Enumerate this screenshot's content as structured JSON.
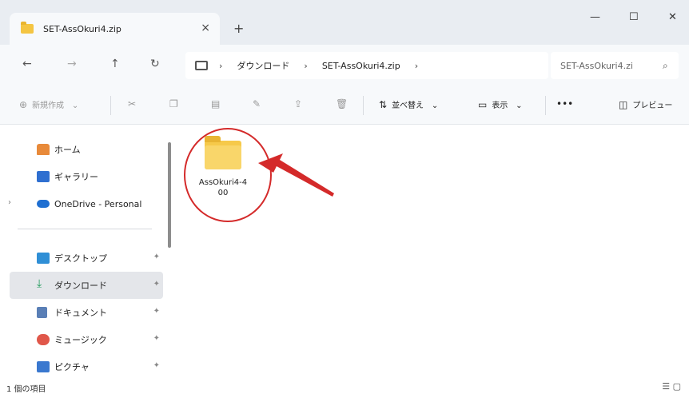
{
  "window": {
    "tab_title": "SET-AssOkuri4.zip",
    "tab_close": "×",
    "new_tab": "+",
    "minimize": "—",
    "maximize": "☐",
    "close": "✕"
  },
  "address": {
    "back": "←",
    "forward": "→",
    "up": "↑",
    "refresh": "↻",
    "breadcrumbs": [
      "ダウンロード",
      "SET-AssOkuri4.zip"
    ],
    "separator": "›",
    "search_placeholder": "SET-AssOkuri4.zi",
    "search_icon": "⌕"
  },
  "toolbar": {
    "new_label": "新規作成",
    "sort_label": "並べ替え",
    "view_label": "表示",
    "more_label": "•••",
    "preview_label": "プレビュー",
    "dropdown_arrow": "⌄"
  },
  "sidebar": {
    "items": [
      {
        "label": "ホーム",
        "icon": "home-icon",
        "pinned": false
      },
      {
        "label": "ギャラリー",
        "icon": "gallery-icon",
        "pinned": false
      },
      {
        "label": "OneDrive - Personal",
        "icon": "onedrive-icon",
        "pinned": false
      },
      {
        "label": "デスクトップ",
        "icon": "desktop-icon",
        "pinned": true
      },
      {
        "label": "ダウンロード",
        "icon": "download-icon",
        "pinned": true,
        "selected": true
      },
      {
        "label": "ドキュメント",
        "icon": "documents-icon",
        "pinned": true
      },
      {
        "label": "ミュージック",
        "icon": "music-icon",
        "pinned": true
      },
      {
        "label": "ピクチャ",
        "icon": "pictures-icon",
        "pinned": true
      }
    ],
    "expander": "›",
    "pin_glyph": "✦"
  },
  "content": {
    "items": [
      {
        "name": "AssOkuri4-400",
        "type": "folder"
      }
    ]
  },
  "status": {
    "item_count": "1 個の項目"
  },
  "colors": {
    "accent_red": "#d42a2a",
    "folder_yellow": "#f6c94a",
    "selection_bg": "#e4e6ea"
  }
}
